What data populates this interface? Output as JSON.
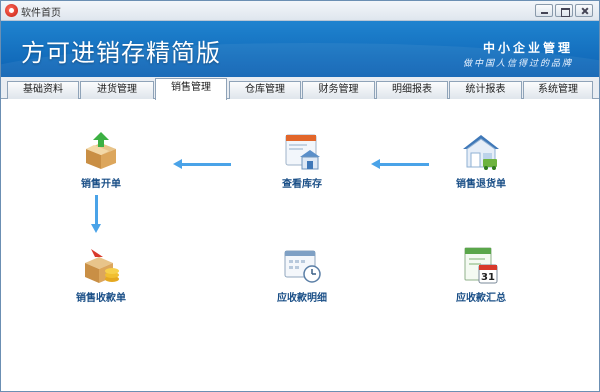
{
  "window": {
    "title": "软件首页"
  },
  "banner": {
    "title": "方可进销存精简版",
    "slogan_main": "中小企业管理",
    "slogan_sub": "做中国人信得过的品牌"
  },
  "tabs": [
    {
      "label": "基础资料"
    },
    {
      "label": "进货管理"
    },
    {
      "label": "销售管理",
      "active": true
    },
    {
      "label": "仓库管理"
    },
    {
      "label": "财务管理"
    },
    {
      "label": "明细报表"
    },
    {
      "label": "统计报表"
    },
    {
      "label": "系统管理"
    }
  ],
  "functions": {
    "sales_order": {
      "label": "销售开单",
      "icon": "box-upload-icon"
    },
    "view_stock": {
      "label": "查看库存",
      "icon": "warehouse-window-icon"
    },
    "sales_return": {
      "label": "销售退货单",
      "icon": "house-return-icon"
    },
    "sales_receipt": {
      "label": "销售收款单",
      "icon": "box-coins-icon"
    },
    "receivable_detail": {
      "label": "应收款明细",
      "icon": "calendar-clock-icon"
    },
    "receivable_summary": {
      "label": "应收款汇总",
      "icon": "calendar-31-icon"
    }
  },
  "calendar_day": "31",
  "colors": {
    "banner": "#1670c2",
    "arrow": "#4aa3e8",
    "label": "#1a4f87"
  }
}
